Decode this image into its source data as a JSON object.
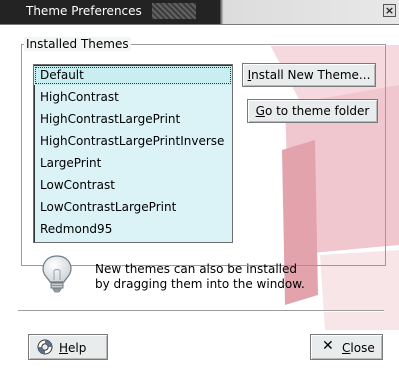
{
  "window": {
    "title": "Theme Preferences",
    "close_glyph": "×"
  },
  "group": {
    "label": "Installed Themes"
  },
  "themes": {
    "items": [
      "Default",
      "HighContrast",
      "HighContrastLargePrint",
      "HighContrastLargePrintInverse",
      "LargePrint",
      "LowContrast",
      "LowContrastLargePrint",
      "Redmond95"
    ],
    "selected_index": 0
  },
  "buttons": {
    "install_prefix": "",
    "install_mnemonic": "I",
    "install_rest": "nstall New Theme...",
    "folder_mnemonic": "G",
    "folder_rest": "o to theme folder",
    "help_mnemonic": "H",
    "help_rest": "elp",
    "close_mnemonic": "C",
    "close_rest": "lose",
    "close_glyph": "✕"
  },
  "info": {
    "icon": "lightbulb-icon",
    "line1": "New themes can also be installed",
    "line2": "by dragging them into the window."
  },
  "colors": {
    "list_bg": "#dbf3f6",
    "watermark_red": "#c0303a",
    "watermark_pink": "#f1c7cf"
  }
}
